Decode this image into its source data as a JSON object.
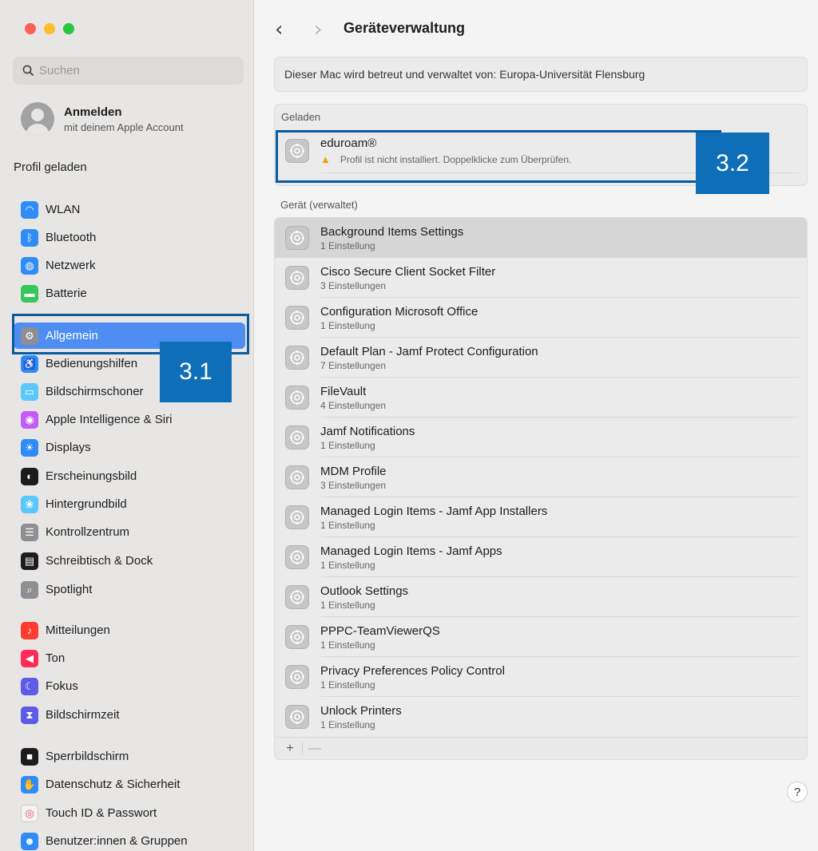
{
  "colors": {
    "accent": "#4e8ef3",
    "annotation": "#0e6eb8"
  },
  "sidebar": {
    "search_placeholder": "Suchen",
    "account": {
      "name": "Anmelden",
      "sub": "mit deinem Apple Account"
    },
    "profile_label": "Profil geladen",
    "items": [
      {
        "label": "WLAN",
        "icon": "wifi-icon",
        "color": "#2f8cf6"
      },
      {
        "label": "Bluetooth",
        "icon": "bluetooth-icon",
        "color": "#2f8cf6"
      },
      {
        "label": "Netzwerk",
        "icon": "globe-icon",
        "color": "#2f8cf6"
      },
      {
        "label": "Batterie",
        "icon": "battery-icon",
        "color": "#35c759"
      },
      {
        "label": "Allgemein",
        "icon": "gear-icon",
        "color": "#8e8e93",
        "active": true
      },
      {
        "label": "Bedienungshilfen",
        "icon": "accessibility-icon",
        "color": "#2f8cf6"
      },
      {
        "label": "Bildschirmschoner",
        "icon": "screensaver-icon",
        "color": "#5ac8fa"
      },
      {
        "label": "Apple Intelligence & Siri",
        "icon": "siri-icon",
        "color": "#c35cf0"
      },
      {
        "label": "Displays",
        "icon": "sun-icon",
        "color": "#2f8cf6"
      },
      {
        "label": "Erscheinungsbild",
        "icon": "appearance-icon",
        "color": "#1c1c1e"
      },
      {
        "label": "Hintergrundbild",
        "icon": "flower-icon",
        "color": "#5ac8fa"
      },
      {
        "label": "Kontrollzentrum",
        "icon": "toggles-icon",
        "color": "#8e8e93"
      },
      {
        "label": "Schreibtisch & Dock",
        "icon": "dock-icon",
        "color": "#1c1c1e"
      },
      {
        "label": "Spotlight",
        "icon": "search-icon",
        "color": "#8e8e93"
      },
      {
        "label": "Mitteilungen",
        "icon": "bell-icon",
        "color": "#ff3b30"
      },
      {
        "label": "Ton",
        "icon": "speaker-icon",
        "color": "#ff2d55"
      },
      {
        "label": "Fokus",
        "icon": "moon-icon",
        "color": "#5e5ce6"
      },
      {
        "label": "Bildschirmzeit",
        "icon": "hourglass-icon",
        "color": "#5e5ce6"
      },
      {
        "label": "Sperrbildschirm",
        "icon": "lock-icon",
        "color": "#1c1c1e"
      },
      {
        "label": "Datenschutz & Sicherheit",
        "icon": "hand-icon",
        "color": "#2f8cf6"
      },
      {
        "label": "Touch ID & Passwort",
        "icon": "fingerprint-icon",
        "color": "#f2f2f2"
      },
      {
        "label": "Benutzer:innen & Gruppen",
        "icon": "users-icon",
        "color": "#2f8cf6"
      }
    ]
  },
  "annotations": {
    "a1": "3.1",
    "a2": "3.2"
  },
  "header": {
    "back": "‹",
    "forward": "›",
    "title": "Geräteverwaltung"
  },
  "managed_by": "Dieser Mac wird betreut und verwaltet von: Europa-Universität Flensburg",
  "loaded": {
    "heading": "Geladen",
    "item": {
      "name": "eduroam®",
      "warning": "Profil ist nicht installiert. Doppelklicke zum Überprüfen."
    }
  },
  "device": {
    "heading": "Gerät (verwaltet)",
    "items": [
      {
        "name": "Background Items Settings",
        "sub": "1 Einstellung",
        "selected": true
      },
      {
        "name": "Cisco Secure Client  Socket Filter",
        "sub": "3 Einstellungen"
      },
      {
        "name": "Configuration Microsoft Office",
        "sub": "1 Einstellung"
      },
      {
        "name": "Default Plan - Jamf Protect Configuration",
        "sub": "7 Einstellungen"
      },
      {
        "name": "FileVault",
        "sub": "4 Einstellungen"
      },
      {
        "name": "Jamf Notifications",
        "sub": "1 Einstellung"
      },
      {
        "name": "MDM Profile",
        "sub": "3 Einstellungen"
      },
      {
        "name": "Managed Login Items - Jamf App Installers",
        "sub": "1 Einstellung"
      },
      {
        "name": "Managed Login Items - Jamf Apps",
        "sub": "1 Einstellung"
      },
      {
        "name": "Outlook Settings",
        "sub": "1 Einstellung"
      },
      {
        "name": "PPPC-TeamViewerQS",
        "sub": "1 Einstellung"
      },
      {
        "name": "Privacy Preferences Policy Control",
        "sub": "1 Einstellung"
      },
      {
        "name": "Unlock Printers",
        "sub": "1 Einstellung"
      }
    ],
    "add": "+",
    "remove": "—"
  },
  "help": "?"
}
